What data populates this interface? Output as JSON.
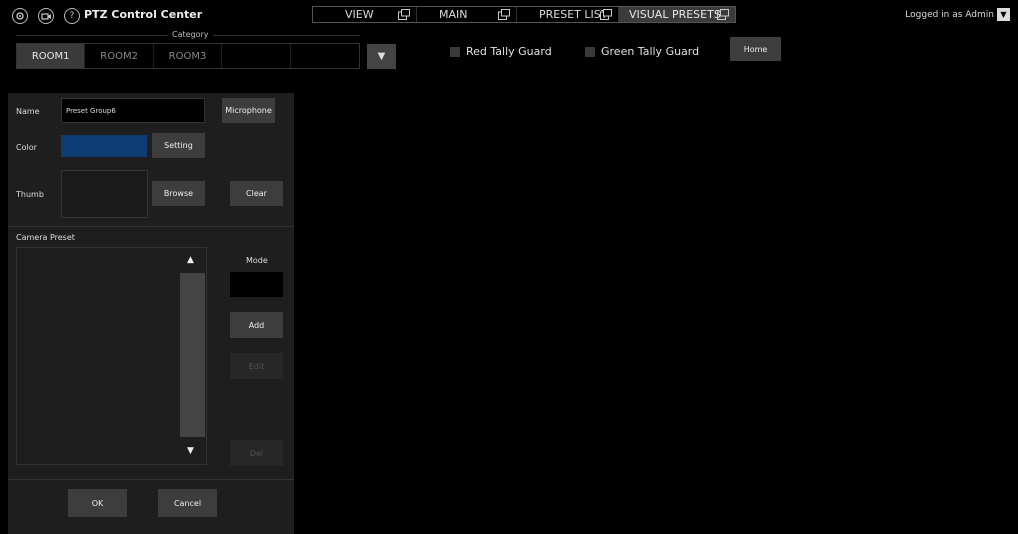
{
  "header": {
    "app_title": "PTZ Control Center",
    "icons": [
      "settings-icon",
      "camera-icon",
      "help-icon"
    ],
    "help_glyph": "?",
    "tabs": [
      {
        "label": "VIEW",
        "active": false
      },
      {
        "label": "MAIN",
        "active": false
      },
      {
        "label": "PRESET LIST",
        "active": false
      },
      {
        "label": "VISUAL PRESETS",
        "active": true
      }
    ],
    "login_text": "Logged in as Admin",
    "login_dropdown_glyph": "▼"
  },
  "category": {
    "label": "Category",
    "tabs": [
      {
        "label": "ROOM1",
        "active": true
      },
      {
        "label": "ROOM2",
        "active": false
      },
      {
        "label": "ROOM3",
        "active": false
      },
      {
        "label": "",
        "active": false
      },
      {
        "label": "",
        "active": false
      }
    ],
    "dropdown_glyph": "▼"
  },
  "guards": {
    "red_label": "Red Tally Guard",
    "green_label": "Green Tally Guard",
    "home_label": "Home"
  },
  "panel": {
    "name_label": "Name",
    "name_value": "Preset Group6",
    "microphone_label": "Microphone",
    "color_label": "Color",
    "color_value": "#0d3c73",
    "setting_label": "Setting",
    "thumb_label": "Thumb",
    "browse_label": "Browse",
    "clear_label": "Clear",
    "camera_preset_label": "Camera Preset",
    "mode_label": "Mode",
    "add_label": "Add",
    "edit_label": "Edit",
    "del_label": "Del",
    "ok_label": "OK",
    "cancel_label": "Cancel",
    "scroll_up_glyph": "▲",
    "scroll_down_glyph": "▼"
  },
  "colors": {
    "background": "#000000",
    "panel": "#1e1e1e",
    "button": "#3d3d3d",
    "accent_blue": "#0d3c73"
  }
}
